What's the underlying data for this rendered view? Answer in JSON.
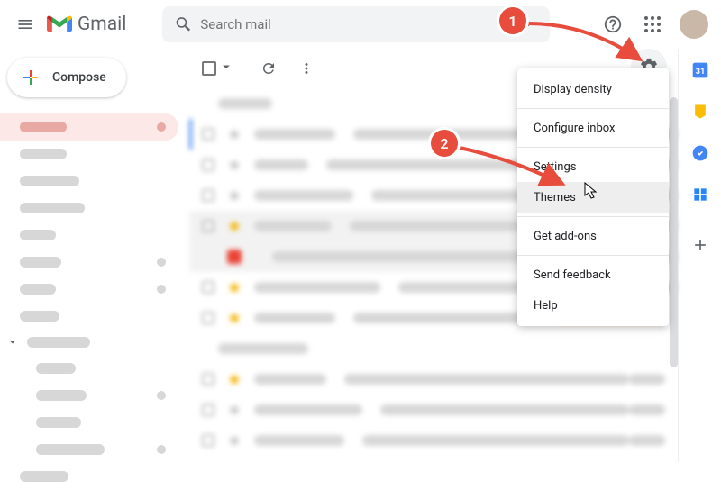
{
  "header": {
    "logo_text": "Gmail",
    "search_placeholder": "Search mail"
  },
  "compose_label": "Compose",
  "settings_menu": {
    "items": [
      "Display density",
      "Configure inbox",
      "Settings",
      "Themes",
      "Get add-ons",
      "Send feedback",
      "Help"
    ]
  },
  "annotations": {
    "marker1": "1",
    "marker2": "2"
  }
}
